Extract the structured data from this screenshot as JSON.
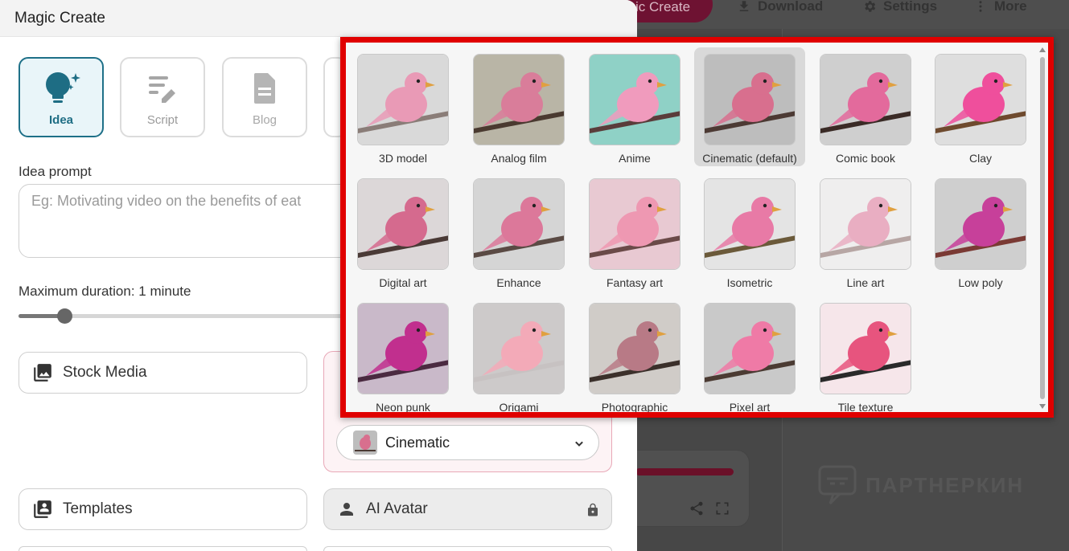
{
  "background": {
    "create_button": "ic Create",
    "toolbar": [
      {
        "label": "Download",
        "icon": "download-icon"
      },
      {
        "label": "Settings",
        "icon": "gear-icon"
      },
      {
        "label": "More",
        "icon": "more-vert-icon"
      }
    ],
    "watermark": "ПАРТНЕРКИН"
  },
  "panel": {
    "title": "Magic Create",
    "modes": [
      {
        "label": "Idea",
        "icon": "lightbulb-sparkle-icon",
        "state": "active"
      },
      {
        "label": "Script",
        "icon": "script-pen-icon",
        "state": "normal"
      },
      {
        "label": "Blog",
        "icon": "document-icon",
        "state": "disabled"
      }
    ],
    "idea_prompt_label": "Idea prompt",
    "idea_prompt_placeholder": "Eg: Motivating video on the benefits of eat",
    "duration_label": "Maximum duration: 1 minute",
    "duration_fraction": 0.135,
    "stock_media_label": "Stock Media",
    "style_select_value": "Cinematic",
    "templates_label": "Templates",
    "ai_avatar_label": "AI Avatar"
  },
  "picker": {
    "styles": [
      {
        "name": "3D model",
        "bg": "#d9d9d9",
        "bird": "#e99ab6",
        "branch": "#8a7d78"
      },
      {
        "name": "Analog film",
        "bg": "#b9b5a6",
        "bird": "#d97d9a",
        "branch": "#4a3a30"
      },
      {
        "name": "Anime",
        "bg": "#8fd1c6",
        "bird": "#f09bbd",
        "branch": "#5a3d3b"
      },
      {
        "name": "Cinematic (default)",
        "bg": "#bdbdbd",
        "bird": "#d86f8e",
        "branch": "#4c3a34",
        "selected": true
      },
      {
        "name": "Comic book",
        "bg": "#cfcfcf",
        "bird": "#e36a9c",
        "branch": "#3a2b26"
      },
      {
        "name": "Clay",
        "bg": "#dedede",
        "bird": "#ef4f9c",
        "branch": "#6e4a2e"
      },
      {
        "name": "Digital art",
        "bg": "#dcd7d8",
        "bird": "#d56a8e",
        "branch": "#4a3a36"
      },
      {
        "name": "Enhance",
        "bg": "#d5d5d5",
        "bird": "#dc789a",
        "branch": "#5a4a44"
      },
      {
        "name": "Fantasy art",
        "bg": "#e8c9d2",
        "bird": "#ee98b2",
        "branch": "#6a4a48"
      },
      {
        "name": "Isometric",
        "bg": "#e4e4e4",
        "bird": "#e87aa6",
        "branch": "#6b5a3a"
      },
      {
        "name": "Line art",
        "bg": "#efeeee",
        "bird": "#e9aec2",
        "branch": "#b7a6a4"
      },
      {
        "name": "Low poly",
        "bg": "#cfcfcf",
        "bird": "#c7409a",
        "branch": "#7a3a34"
      },
      {
        "name": "Neon punk",
        "bg": "#c9b9c9",
        "bird": "#c12f8e",
        "branch": "#4a2a40"
      },
      {
        "name": "Origami",
        "bg": "#cdcaca",
        "bird": "#f3aab8",
        "branch": "#c7c2c2"
      },
      {
        "name": "Photographic",
        "bg": "#d0ccc8",
        "bird": "#b87a86",
        "branch": "#3b302b"
      },
      {
        "name": "Pixel art",
        "bg": "#c9c9c9",
        "bird": "#ef7aa6",
        "branch": "#4b3b33"
      },
      {
        "name": "Tile texture",
        "bg": "#f6e6ea",
        "bird": "#e7547e",
        "branch": "#2a2a2a"
      }
    ]
  }
}
